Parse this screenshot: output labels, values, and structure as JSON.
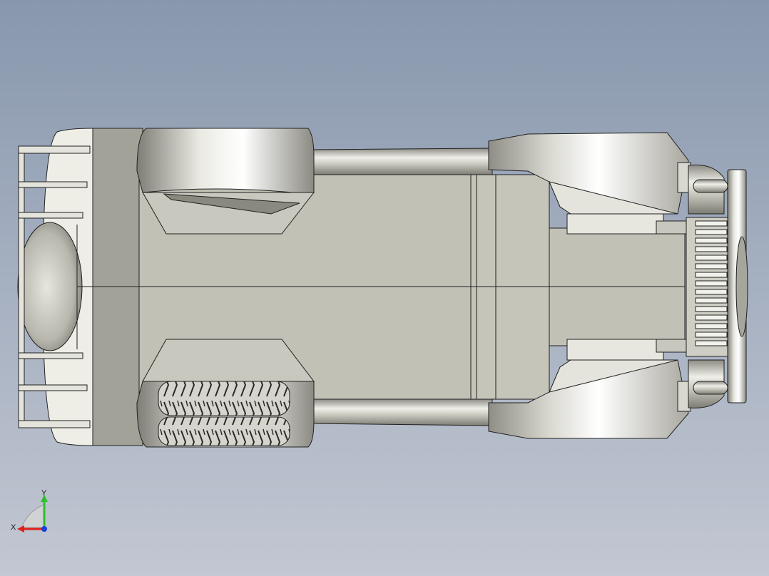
{
  "viewport": {
    "background_top": "#8897ad",
    "background_bottom": "#c2c7d2"
  },
  "model": {
    "body_color": "#c2c1b6",
    "shade_color": "#8e8d84",
    "highlight_color": "#f4f4ef",
    "edge_color": "#202020"
  },
  "triad": {
    "x_label": "X",
    "y_label": "Y",
    "x_color": "#e0201c",
    "y_color": "#2fbf2a",
    "z_color": "#1d3fd8"
  }
}
